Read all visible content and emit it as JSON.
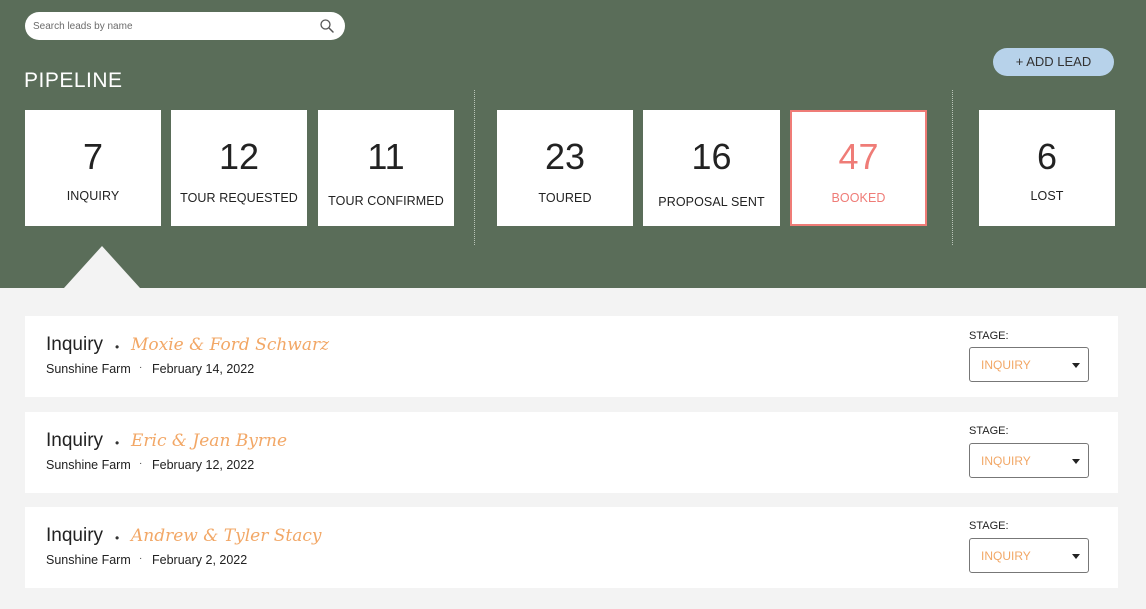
{
  "search": {
    "placeholder": "Search leads by name",
    "icon": "search-icon"
  },
  "header": {
    "title": "PIPELINE",
    "add_lead_label": "+ ADD LEAD"
  },
  "pipeline": [
    {
      "count": "7",
      "label": "INQUIRY"
    },
    {
      "count": "12",
      "label": "TOUR REQUESTED"
    },
    {
      "count": "11",
      "label": "TOUR CONFIRMED"
    },
    {
      "count": "23",
      "label": "TOURED"
    },
    {
      "count": "16",
      "label": "PROPOSAL SENT"
    },
    {
      "count": "47",
      "label": "BOOKED",
      "active": true
    },
    {
      "count": "6",
      "label": "LOST"
    }
  ],
  "colors": {
    "header_bg": "#5a6d59",
    "accent_booked": "#ef7c77",
    "lead_name": "#f2a766",
    "add_lead_bg": "#b7d2ea"
  },
  "leads": [
    {
      "stage": "Inquiry",
      "name": "Moxie & Ford Schwarz",
      "venue": "Sunshine Farm",
      "date": "February 14, 2022",
      "stage_label": "STAGE:",
      "stage_value": "INQUIRY"
    },
    {
      "stage": "Inquiry",
      "name": "Eric & Jean Byrne",
      "venue": "Sunshine Farm",
      "date": "February 12, 2022",
      "stage_label": "STAGE:",
      "stage_value": "INQUIRY"
    },
    {
      "stage": "Inquiry",
      "name": "Andrew & Tyler Stacy",
      "venue": "Sunshine Farm",
      "date": "February 2, 2022",
      "stage_label": "STAGE:",
      "stage_value": "INQUIRY"
    }
  ]
}
